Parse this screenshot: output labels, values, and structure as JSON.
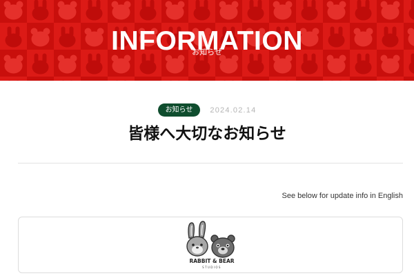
{
  "hero": {
    "title": "INFORMATION",
    "subtitle": "お知らせ",
    "background_color": "#d3120f",
    "pattern_icons": [
      "rabbit-head-icon",
      "bear-head-icon"
    ]
  },
  "article": {
    "category": "お知らせ",
    "category_color": "#0f4d2e",
    "date": "2024.02.14",
    "title": "皆様へ大切なお知らせ",
    "english_link": "See below for update info in English"
  },
  "logo": {
    "text": "RABBIT & BEAR",
    "subtext": "STUDIOS",
    "icons": [
      "rabbit-mascot-icon",
      "bear-mascot-icon"
    ]
  }
}
